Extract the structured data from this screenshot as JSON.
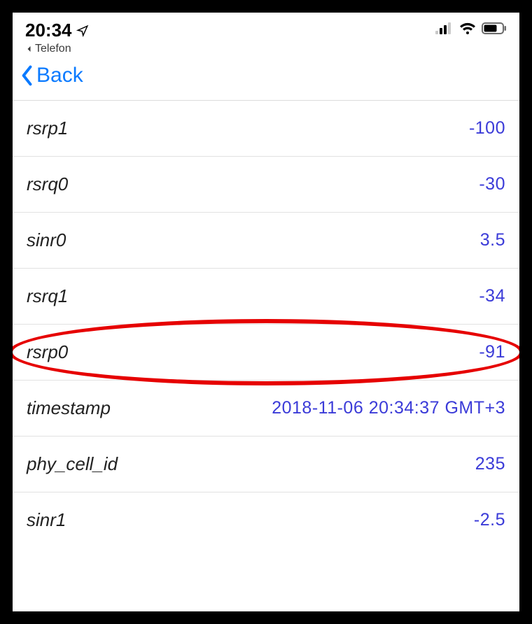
{
  "statusBar": {
    "time": "20:34",
    "backApp": "Telefon"
  },
  "nav": {
    "backLabel": "Back"
  },
  "rows": [
    {
      "label": "rsrp1",
      "value": "-100",
      "highlight": false
    },
    {
      "label": "rsrq0",
      "value": "-30",
      "highlight": false
    },
    {
      "label": "sinr0",
      "value": "3.5",
      "highlight": false
    },
    {
      "label": "rsrq1",
      "value": "-34",
      "highlight": false
    },
    {
      "label": "rsrp0",
      "value": "-91",
      "highlight": true
    },
    {
      "label": "timestamp",
      "value": "2018-11-06 20:34:37 GMT+3",
      "highlight": false
    },
    {
      "label": "phy_cell_id",
      "value": "235",
      "highlight": false
    },
    {
      "label": "sinr1",
      "value": "-2.5",
      "highlight": false
    }
  ]
}
